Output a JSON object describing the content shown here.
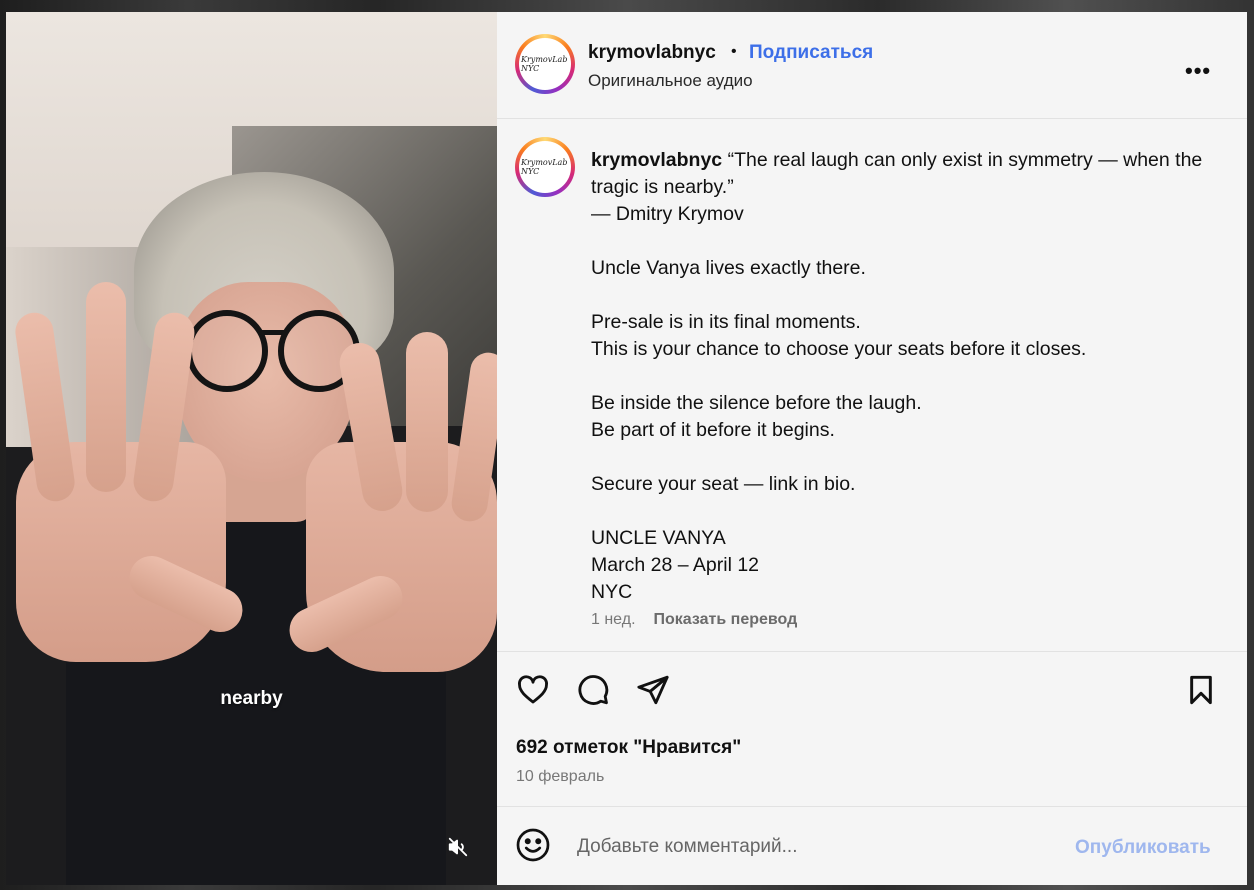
{
  "post": {
    "video": {
      "overlay_caption": "nearby",
      "mute_icon": "speaker-muted-icon"
    },
    "header": {
      "username": "krymovlabnyc",
      "separator": "•",
      "follow_label": "Подписаться",
      "subtitle": "Оригинальное аудио",
      "avatar_text": "KrymovLab NYC",
      "more_icon": "•••"
    },
    "caption": {
      "username": "krymovlabnyc",
      "text": " “The real laugh can only exist in symmetry — when the tragic is nearby.”\n— Dmitry Krymov\n\nUncle Vanya lives exactly there.\n\nPre-sale is in its final moments.\nThis is your chance to choose your seats before it closes.\n\nBe inside the silence before the laugh.\nBe part of it before it begins.\n\nSecure your seat — link in bio.\n\nUNCLE VANYA\nMarch 28 – April 12\nNYC",
      "age": "1 нед.",
      "translate_label": "Показать перевод"
    },
    "actions": {
      "likes_text": "692 отметок \"Нравится\"",
      "date": "10 февраль"
    },
    "composer": {
      "placeholder": "Добавьте комментарий...",
      "publish_label": "Опубликовать"
    }
  },
  "colors": {
    "accent": "#3d6fe8",
    "publish_disabled": "#9fb7ee",
    "panel_bg": "#f5f5f5"
  }
}
